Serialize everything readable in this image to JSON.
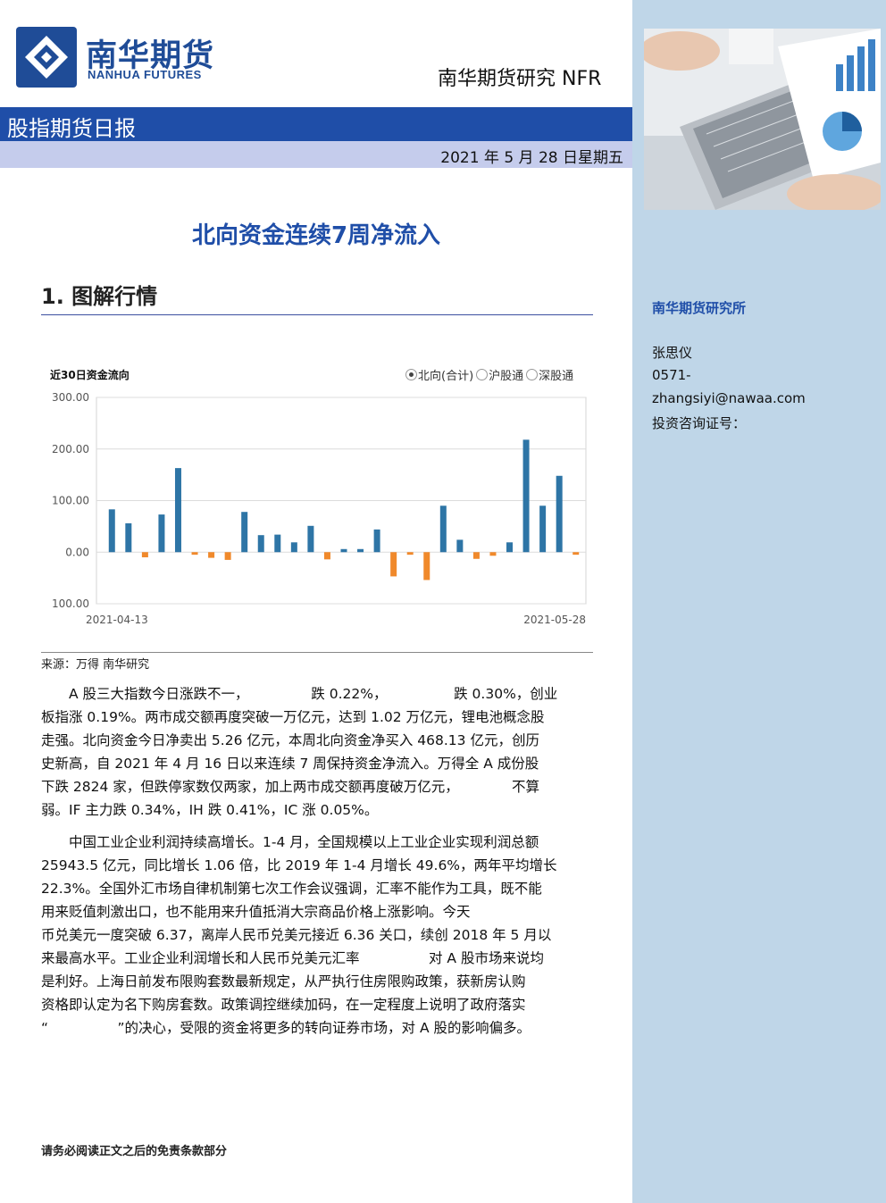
{
  "header": {
    "logo_cn": "南华期货",
    "logo_en": "NANHUA FUTURES",
    "brand_right": "南华期货研究  NFR",
    "report_type": "股指期货日报",
    "date": "2021 年 5 月 28 日星期五"
  },
  "headline": "北向资金连续7周净流入",
  "section_title": "1. 图解行情",
  "chart": {
    "title": "近30日资金流向",
    "legend": [
      {
        "label": "北向(合计)",
        "selected": true
      },
      {
        "label": "沪股通",
        "selected": false
      },
      {
        "label": "深股通",
        "selected": false
      }
    ],
    "source": "来源：万得  南华研究"
  },
  "chart_data": {
    "type": "bar",
    "title": "近30日资金流向",
    "ylim": [
      -100,
      300
    ],
    "yticks": [
      "300.00",
      "200.00",
      "100.00",
      "0.00",
      "100.00"
    ],
    "ytick_values": [
      300,
      200,
      100,
      0,
      -100
    ],
    "x_start_label": "2021-04-13",
    "x_end_label": "2021-05-28",
    "values": [
      83,
      56,
      -10,
      73,
      163,
      -5,
      -11,
      -15,
      78,
      33,
      34,
      19,
      51,
      -14,
      6,
      6,
      44,
      -47,
      -5,
      -54,
      90,
      24,
      -13,
      -7,
      19,
      218,
      90,
      148,
      -5
    ],
    "colors": {
      "positive": "#2e75a6",
      "negative": "#f0892b"
    },
    "grid": true
  },
  "paragraphs": [
    {
      "lines": [
        "A 股三大指数今日涨跌不一，　　　　　跌 0.22%，　　　　　 跌 0.30%，创业",
        "板指涨 0.19%。两市成交额再度突破一万亿元，达到 1.02 万亿元，锂电池概念股",
        "走强。北向资金今日净卖出 5.26 亿元，本周北向资金净买入 468.13 亿元，创历",
        "史新高，自 2021 年 4 月 16 日以来连续 7 周保持资金净流入。万得全 A 成份股",
        "下跌 2824 家，但跌停家数仅两家，加上两市成交额再度破万亿元，　　　　 不算",
        "弱。IF 主力跌 0.34%，IH 跌 0.41%，IC 涨 0.05%。"
      ]
    },
    {
      "lines": [
        "中国工业企业利润持续高增长。1-4 月，全国规模以上工业企业实现利润总额",
        "25943.5 亿元，同比增长 1.06 倍，比 2019 年 1-4 月增长 49.6%，两年平均增长",
        "22.3%。全国外汇市场自律机制第七次工作会议强调，汇率不能作为工具，既不能",
        "用来贬值刺激出口，也不能用来升值抵消大宗商品价格上涨影响。今天",
        "币兑美元一度突破 6.37，离岸人民币兑美元接近 6.36 关口，续创 2018 年 5 月以",
        "来最高水平。工业企业利润增长和人民币兑美元汇率　　　　　对 A 股市场来说均",
        "是利好。上海日前发布限购套数最新规定，从严执行住房限购政策，获新房认购",
        "资格即认定为名下购房套数。政策调控继续加码，在一定程度上说明了政府落实",
        "“　　　　　”的决心，受限的资金将更多的转向证券市场，对 A 股的影响偏多。"
      ]
    }
  ],
  "sidebar": {
    "institute": "南华期货研究所",
    "name": "张思仪",
    "phone": "0571-",
    "email": "zhangsiyi@nawaa.com",
    "license": "投资咨询证号："
  },
  "footer": "请务必阅读正文之后的免责条款部分"
}
